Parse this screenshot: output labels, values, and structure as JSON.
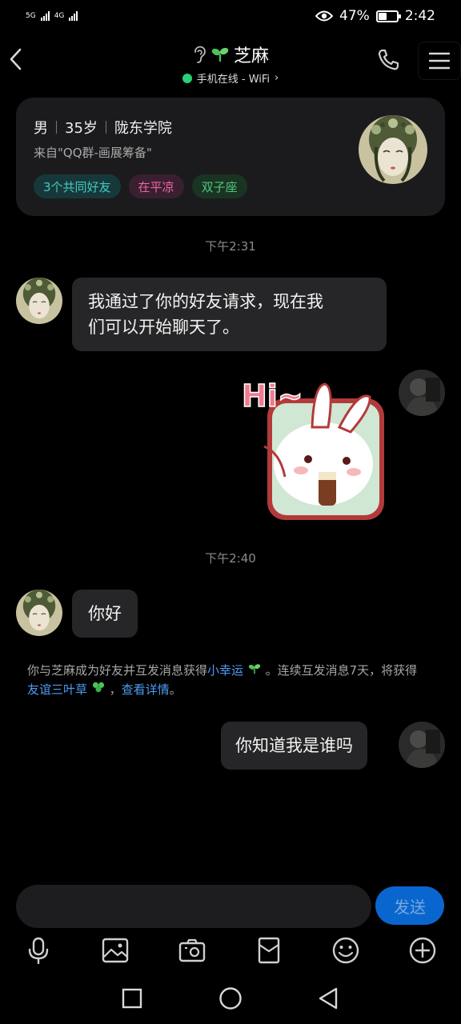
{
  "status_bar": {
    "network_left": "5G",
    "network_right": "4G",
    "battery_percent": "47%",
    "battery_level": 0.47,
    "time": "2:42"
  },
  "header": {
    "contact_name": "芝麻",
    "online_status": "手机在线 - WiFi",
    "online_arrow": "›",
    "icons": [
      "back-arrow-icon",
      "ear-icon",
      "sprout-icon",
      "phone-icon",
      "menu-icon"
    ]
  },
  "profile_card": {
    "gender": "男",
    "age": "35岁",
    "school": "陇东学院",
    "source": "来自\"QQ群-画展筹备\"",
    "tags": {
      "mutual_friends": "3个共同好友",
      "location": "在平凉",
      "zodiac": "双子座"
    }
  },
  "messages": {
    "time_1": "下午2:31",
    "msg_1": {
      "line1": "我通过了你的好友请求，现在我",
      "line2": "们可以开始聊天了。"
    },
    "sticker_text": "Hi~",
    "time_2": "下午2:40",
    "msg_2": "你好",
    "system": {
      "part1": "你与芝麻成为好友并互发消息获得",
      "link1": "小幸运",
      "part2": "。连续互发消息7天，将获得",
      "link2": "友谊三叶草",
      "part3": "，",
      "link3": "查看详情",
      "part4": "。"
    },
    "msg_3": "你知道我是谁吗"
  },
  "input": {
    "value": "",
    "placeholder": "",
    "send_label": "发送"
  },
  "toolbar": [
    "microphone-icon",
    "image-icon",
    "camera-icon",
    "red-packet-icon",
    "emoji-icon",
    "add-icon"
  ],
  "navbar": [
    "recent-apps-icon",
    "home-icon",
    "back-icon"
  ],
  "colors": {
    "accent_blue": "#0a66cf",
    "link_blue": "#4e9cf5",
    "online_green": "#28d07a",
    "bubble_bg": "#262628"
  }
}
